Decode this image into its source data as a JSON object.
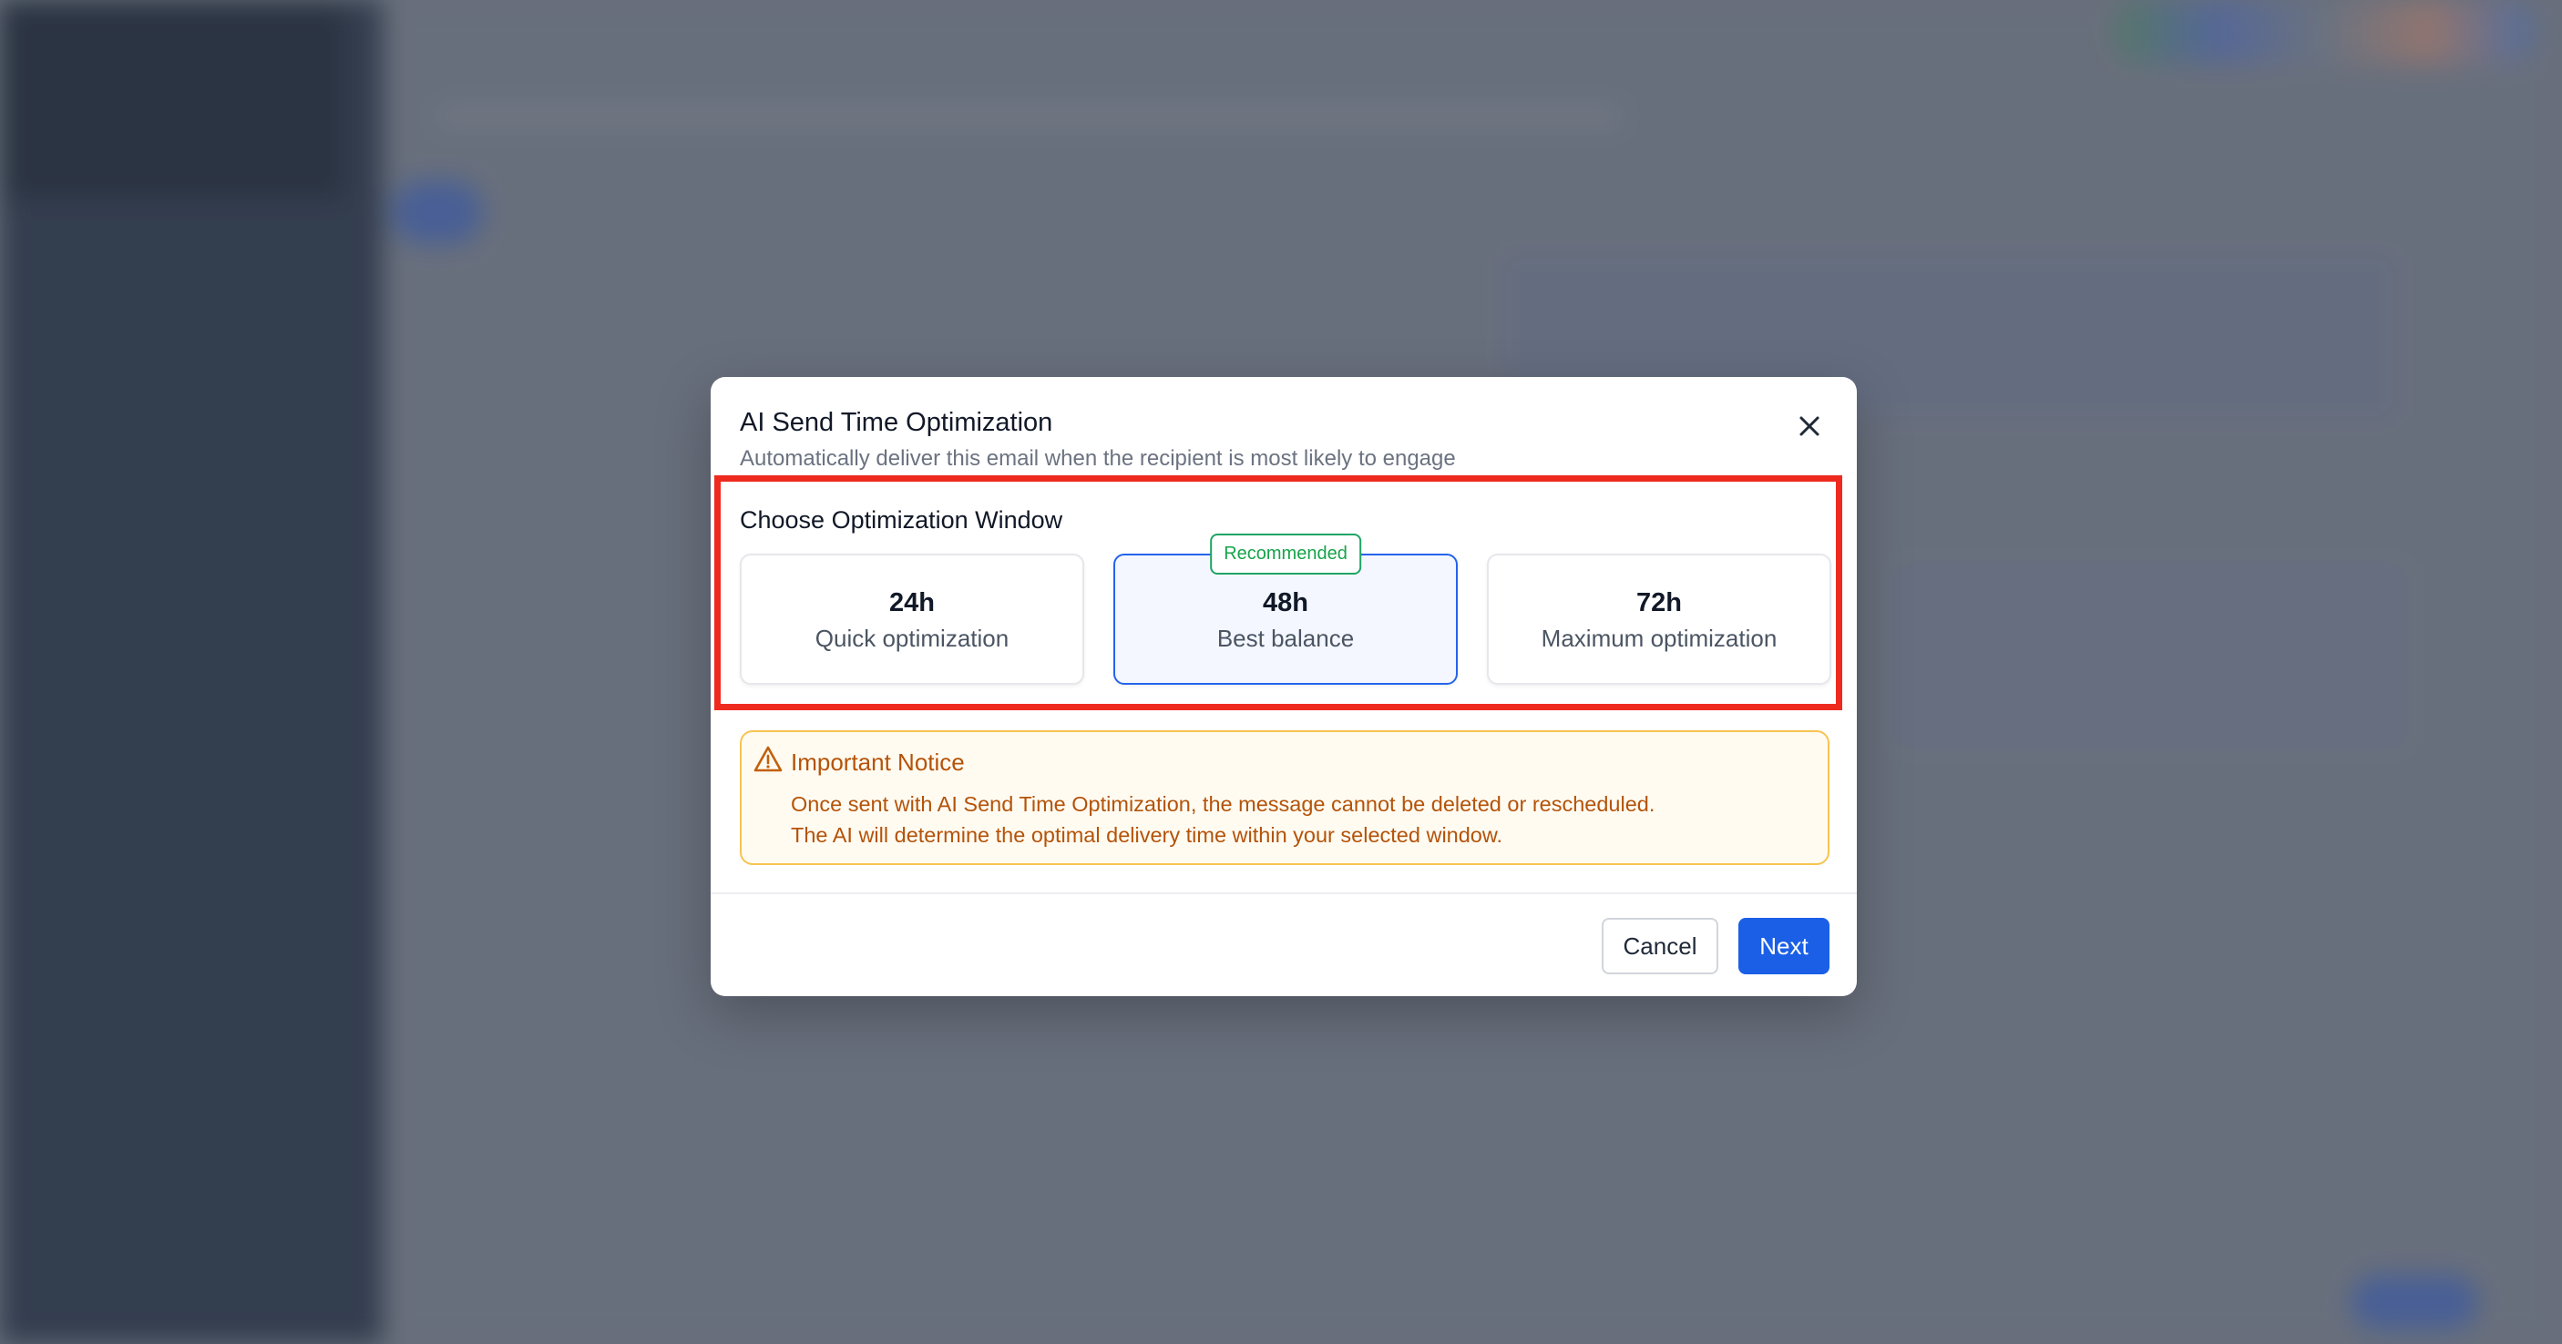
{
  "modal": {
    "title": "AI Send Time Optimization",
    "subtitle": "Automatically deliver this email when the recipient is most likely to engage",
    "close_icon": "close-icon"
  },
  "optimization": {
    "section_title": "Choose Optimization Window",
    "selected": "48h",
    "options": [
      {
        "value": "24h",
        "description": "Quick optimization"
      },
      {
        "value": "48h",
        "description": "Best balance",
        "badge": "Recommended"
      },
      {
        "value": "72h",
        "description": "Maximum optimization"
      }
    ]
  },
  "notice": {
    "icon": "warning-icon",
    "title": "Important Notice",
    "line1": "Once sent with AI Send Time Optimization, the message cannot be deleted or rescheduled.",
    "line2": "The AI will determine the optimal delivery time within your selected window."
  },
  "footer": {
    "cancel_label": "Cancel",
    "next_label": "Next"
  },
  "colors": {
    "accent": "#1a5fe6",
    "selected_border": "#2563eb",
    "recommended_green": "#16a34a",
    "warning_text": "#b45309",
    "warning_border": "#f7c451",
    "highlight_red": "#ee2a1f"
  }
}
